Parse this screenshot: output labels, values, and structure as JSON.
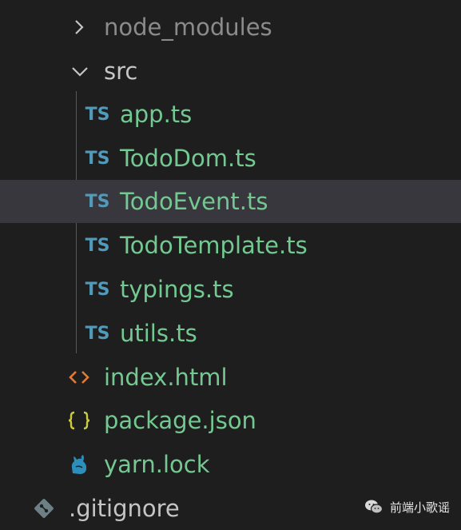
{
  "explorer": {
    "items": [
      {
        "label": "node_modules",
        "type": "folder",
        "state": "collapsed",
        "icon": "chevron-right-icon"
      },
      {
        "label": "src",
        "type": "folder",
        "state": "expanded",
        "icon": "chevron-down-icon"
      },
      {
        "label": "app.ts",
        "type": "file",
        "icon_text": "TS"
      },
      {
        "label": "TodoDom.ts",
        "type": "file",
        "icon_text": "TS"
      },
      {
        "label": "TodoEvent.ts",
        "type": "file",
        "icon_text": "TS",
        "selected": true
      },
      {
        "label": "TodoTemplate.ts",
        "type": "file",
        "icon_text": "TS"
      },
      {
        "label": "typings.ts",
        "type": "file",
        "icon_text": "TS"
      },
      {
        "label": "utils.ts",
        "type": "file",
        "icon_text": "TS"
      },
      {
        "label": "index.html",
        "type": "file",
        "icon": "html-icon"
      },
      {
        "label": "package.json",
        "type": "file",
        "icon": "json-icon"
      },
      {
        "label": "yarn.lock",
        "type": "file",
        "icon": "yarn-icon"
      },
      {
        "label": ".gitignore",
        "type": "file",
        "icon": "git-icon"
      }
    ]
  },
  "colors": {
    "background": "#1e1e1e",
    "selected_row": "#37373d",
    "file_text": "#73c991",
    "folder_text": "#c5c5c5",
    "ignored_text": "#8b8b8b",
    "ts_icon": "#519aba",
    "html_icon": "#e37933",
    "json_icon": "#cbcb41",
    "yarn_icon": "#2c8ebb",
    "git_icon": "#6d8086"
  },
  "watermark": {
    "text": "前端小歌谣",
    "icon": "wechat-icon"
  }
}
